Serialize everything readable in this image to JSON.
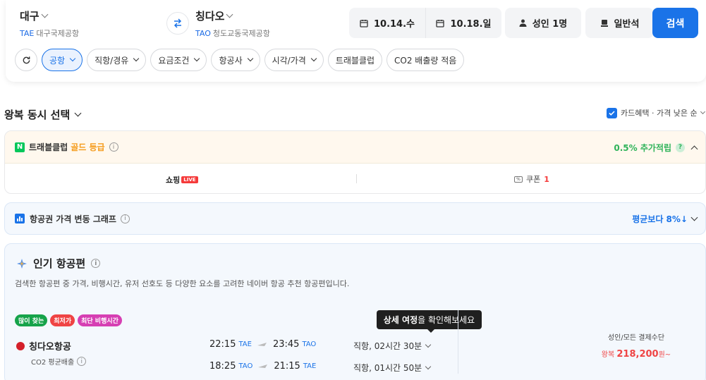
{
  "search": {
    "from": {
      "city": "대구",
      "code": "TAE",
      "airport": "대구국제공항"
    },
    "to": {
      "city": "칭다오",
      "code": "TAO",
      "airport": "청도교동국제공항"
    },
    "depart_date": "10.14.수",
    "return_date": "10.18.일",
    "passengers": "성인 1명",
    "cabin": "일반석",
    "search_label": "검색"
  },
  "filters": [
    "공항",
    "직항/경유",
    "요금조건",
    "항공사",
    "시각/가격",
    "트래블클럽",
    "CO2 배출량 적음"
  ],
  "section": {
    "title": "왕복 동시 선택",
    "card_benefit": "카드혜택 · 가격 낮은 순"
  },
  "club": {
    "title": "트래블클럽",
    "grade": "골드 등급",
    "reward": "0.5% 추가적립",
    "shopping": "쇼핑",
    "live": "LIVE",
    "coupon_label": "쿠폰",
    "coupon_count": "1"
  },
  "graph": {
    "title": "항공권 가격 변동 그래프",
    "compare": "평균보다 8%↓"
  },
  "popular": {
    "title": "인기 항공편",
    "description": "검색한 항공편 중 가격, 비행시간, 유저 선호도 등 다양한 요소를 고려한 네이버 항공 추천 항공편입니다.",
    "badges": [
      "많이 찾는",
      "최저가",
      "최단 비행시간"
    ],
    "tooltip_bold": "상세 여정",
    "tooltip_rest": "을 확인해보세요",
    "flight": {
      "airline": "칭다오항공",
      "co2": "CO2 평균배출",
      "outbound": {
        "dep_time": "22:15",
        "dep_code": "TAE",
        "arr_time": "23:45",
        "arr_code": "TAO",
        "duration": "직항, 02시간 30분"
      },
      "inbound": {
        "dep_time": "18:25",
        "dep_code": "TAO",
        "arr_time": "21:15",
        "arr_code": "TAE",
        "duration": "직항, 01시간 50분"
      },
      "price_label": "성인/모든 결제수단",
      "price_prefix": "왕복",
      "price": "218,200",
      "price_suffix": "원~"
    }
  },
  "colors": {
    "accent": "#1a73e8",
    "green": "#2fb35a",
    "red": "#ef4444",
    "gold": "#f59b1c"
  }
}
